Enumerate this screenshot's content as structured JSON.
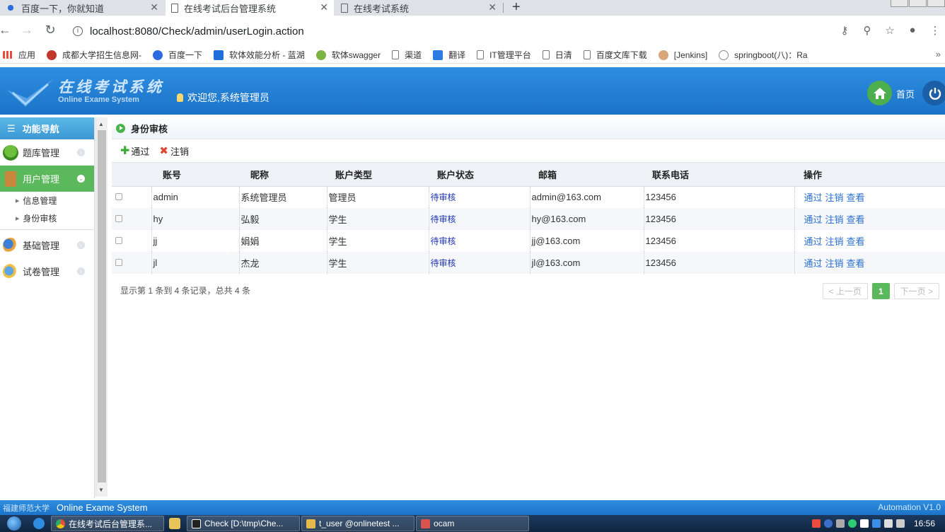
{
  "browser": {
    "tabs": [
      {
        "title": "百度一下，你就知道",
        "active": false
      },
      {
        "title": "在线考试后台管理系统",
        "active": true
      },
      {
        "title": "在线考试系统",
        "active": false
      }
    ],
    "url": "localhost:8080/Check/admin/userLogin.action",
    "bookmarks": [
      "应用",
      "成都大学招生信息网-",
      "百度一下",
      "软体效能分析 - 蓝湖",
      "软体swagger",
      "渠道",
      "翻译",
      "IT管理平台",
      "日清",
      "百度文库下载",
      "[Jenkins]",
      "springboot(八)：Ra"
    ]
  },
  "header": {
    "logo_cn": "在线考试系统",
    "logo_en": "Online Exame System",
    "welcome": "欢迎您,系统管理员",
    "home_label": "首页"
  },
  "sidebar": {
    "title": "功能导航",
    "items": [
      {
        "label": "题库管理"
      },
      {
        "label": "用户管理"
      },
      {
        "label": "基础管理"
      },
      {
        "label": "试卷管理"
      }
    ],
    "subitems": [
      {
        "label": "信息管理"
      },
      {
        "label": "身份审核"
      }
    ]
  },
  "panel": {
    "title": "身份审核",
    "approve_label": "通过",
    "cancel_label": "注销"
  },
  "table": {
    "columns": [
      "账号",
      "昵称",
      "账户类型",
      "账户状态",
      "邮箱",
      "联系电话",
      "操作"
    ],
    "rows": [
      {
        "account": "admin",
        "nickname": "系统管理员",
        "type": "管理员",
        "status": "待审核",
        "email": "admin@163.com",
        "phone": "123456"
      },
      {
        "account": "hy",
        "nickname": "弘毅",
        "type": "学生",
        "status": "待审核",
        "email": "hy@163.com",
        "phone": "123456"
      },
      {
        "account": "jj",
        "nickname": "娟娟",
        "type": "学生",
        "status": "待审核",
        "email": "jj@163.com",
        "phone": "123456"
      },
      {
        "account": "jl",
        "nickname": "杰龙",
        "type": "学生",
        "status": "待审核",
        "email": "jl@163.com",
        "phone": "123456"
      }
    ],
    "actions": {
      "approve": "通过",
      "cancel": "注销",
      "view": "查看"
    }
  },
  "pager": {
    "info": "显示第 1 条到 4 条记录，总共 4 条",
    "prev": "< 上一页",
    "current": "1",
    "next": "下一页 >"
  },
  "footer": {
    "school": "福建师范大学",
    "system": "Online Exame System",
    "version": "Automation V1.0"
  },
  "taskbar": {
    "items": [
      "在线考试后台管理系...",
      "Check [D:\\tmp\\Che...",
      "t_user @onlinetest ...",
      "ocam"
    ],
    "clock": "16:56"
  },
  "colors": {
    "header_blue": "#1b73c8",
    "accent_green": "#5cb85c",
    "status_link": "#1b34b0"
  }
}
